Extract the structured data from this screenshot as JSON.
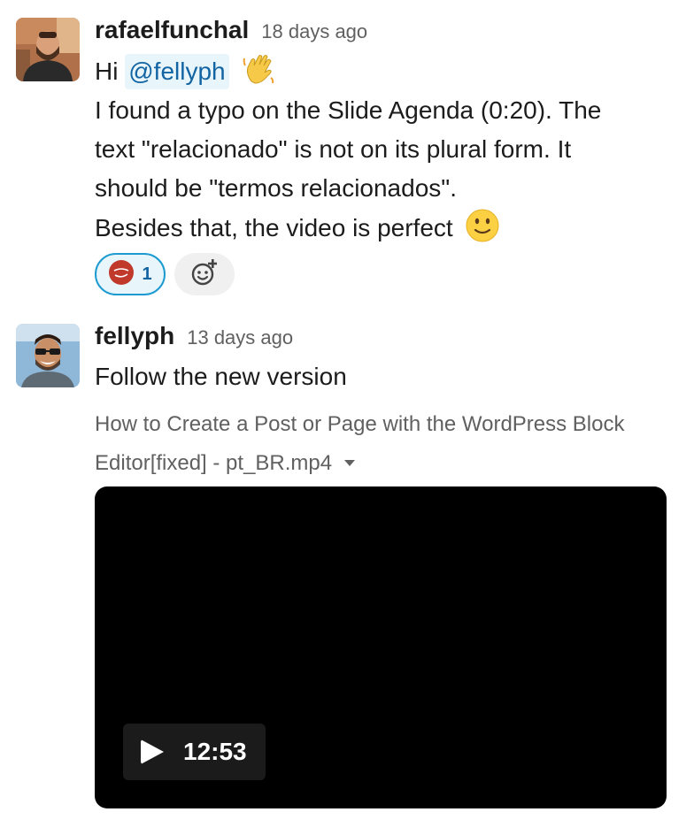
{
  "messages": [
    {
      "username": "rafaelfunchal",
      "timestamp": "18 days ago",
      "greeting": "Hi",
      "mention": "@fellyph",
      "lines": [
        "I found a typo on the Slide Agenda (0:20). The",
        "text \"relacionado\" is not on its plural form. It",
        "should be \"termos relacionados\".",
        "Besides that, the video is perfect"
      ],
      "reactions": [
        {
          "emoji": "thank-you-sticker",
          "count": "1"
        }
      ],
      "add_reaction_icon": "add-reaction-icon"
    },
    {
      "username": "fellyph",
      "timestamp": "13 days ago",
      "text": "Follow the new version",
      "file": {
        "name_line1": "How to Create a Post or Page with the WordPress Block",
        "name_line2": "Editor[fixed] - pt_BR.mp4",
        "duration": "12:53"
      }
    }
  ],
  "colors": {
    "mention_bg": "#e8f5fa",
    "mention_text": "#1264a3",
    "reaction_border": "#1d9bd1",
    "video_bg": "#000000"
  }
}
